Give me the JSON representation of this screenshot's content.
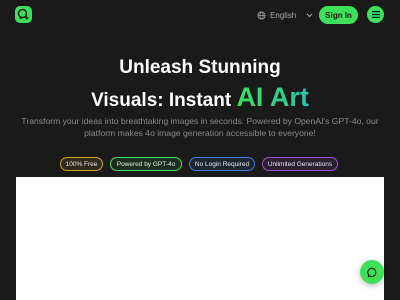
{
  "header": {
    "logo_icon": "chat-sparkle-logo-icon",
    "language": {
      "icon": "globe-icon",
      "label": "English",
      "chevron_icon": "chevron-down-icon"
    },
    "signin_label": "Sign In",
    "menu_icon": "hamburger-menu-icon"
  },
  "hero": {
    "title_line1": "Unleash Stunning",
    "title_line2_prefix": "Visuals: Instant",
    "title_accent": "AI Art",
    "subtitle_line1": "Transform your ideas into breathtaking images in seconds. Powered by OpenAI's GPT-4o, our",
    "subtitle_line2": "platform makes 4o image generation accessible to everyone!"
  },
  "badges": [
    {
      "label": "100% Free",
      "color": "#d6a426"
    },
    {
      "label": "Powered by GPT-4o",
      "color": "#3ee05a"
    },
    {
      "label": "No Login Required",
      "color": "#3d7bdc"
    },
    {
      "label": "Unlimited Generations",
      "color": "#9a4fd8"
    }
  ],
  "chat_button_icon": "chat-bubble-icon",
  "colors": {
    "background": "#1a1a1a",
    "accent": "#3ee05a",
    "accent_gradient_end": "#29c4a8",
    "muted_text": "#8a8a8a"
  }
}
